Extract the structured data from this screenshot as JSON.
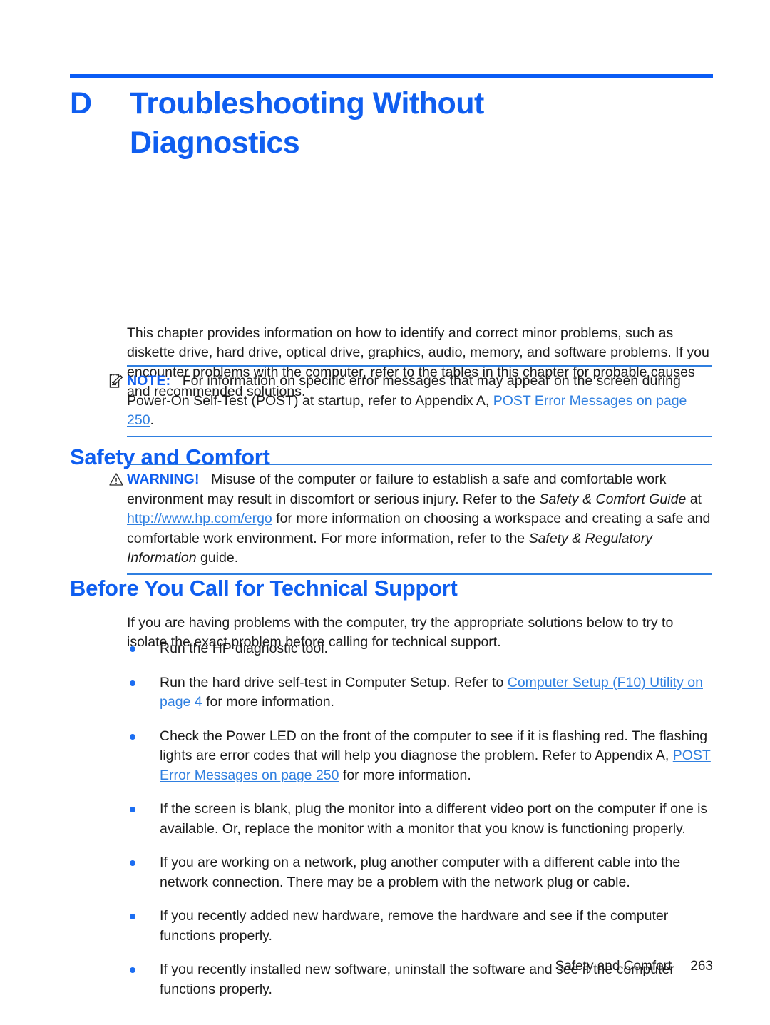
{
  "chapter": {
    "letter": "D",
    "title": "Troubleshooting Without Diagnostics"
  },
  "intro": {
    "paragraph": "This chapter provides information on how to identify and correct minor problems, such as diskette drive, hard drive, optical drive, graphics, audio, memory, and software problems. If you encounter problems with the computer, refer to the tables in this chapter for probable causes and recommended solutions."
  },
  "note": {
    "icon": "note-pad-pencil-icon",
    "label": "NOTE:",
    "text_before_link": "For information on specific error messages that may appear on the screen during Power-On Self-Test (POST) at startup, refer to Appendix A, ",
    "link": "POST Error Messages on page 250",
    "text_after_link": "."
  },
  "headings": {
    "safety_and_comfort": "Safety and Comfort",
    "before_you_call": "Before You Call for Technical Support"
  },
  "warning": {
    "icon": "warning-triangle-icon",
    "label": "WARNING!",
    "part1": "Misuse of the computer or failure to establish a safe and comfortable work environment may result in discomfort or serious injury. Refer to the ",
    "italic1": "Safety & Comfort Guide",
    "part2": " at ",
    "link": "http://www.hp.com/ergo",
    "part3": " for more information on choosing a workspace and creating a safe and comfortable work environment. For more information, refer to the ",
    "italic2": "Safety & Regulatory Information",
    "part4": " guide."
  },
  "before_you_call": {
    "lead": "If you are having problems with the computer, try the appropriate solutions below to try to isolate the exact problem before calling for technical support.",
    "bullets": [
      {
        "part1": "Run the HP diagnostic tool.",
        "link": "",
        "part2": ""
      },
      {
        "part1": "Run the hard drive self-test in Computer Setup. Refer to ",
        "link": "Computer Setup (F10) Utility on page 4",
        "part2": " for more information."
      },
      {
        "part1": "Check the Power LED on the front of the computer to see if it is flashing red. The flashing lights are error codes that will help you diagnose the problem. Refer to Appendix A, ",
        "link": "POST Error Messages on page 250",
        "part2": " for more information."
      },
      {
        "part1": "If the screen is blank, plug the monitor into a different video port on the computer if one is available. Or, replace the monitor with a monitor that you know is functioning properly.",
        "link": "",
        "part2": ""
      },
      {
        "part1": "If you are working on a network, plug another computer with a different cable into the network connection. There may be a problem with the network plug or cable.",
        "link": "",
        "part2": ""
      },
      {
        "part1": "If you recently added new hardware, remove the hardware and see if the computer functions properly.",
        "link": "",
        "part2": ""
      },
      {
        "part1": "If you recently installed new software, uninstall the software and see if the computer functions properly.",
        "link": "",
        "part2": ""
      }
    ]
  },
  "footer": {
    "section": "Safety and Comfort",
    "page_number": "263"
  },
  "colors": {
    "heading_blue": "#0f5ef0",
    "rule_blue": "#0a5cf5",
    "admon_rule_blue": "#2f7fe0",
    "link_blue": "#2f7fe0",
    "bullet_blue": "#1c6ef2",
    "body_text": "#1c1c1c"
  }
}
